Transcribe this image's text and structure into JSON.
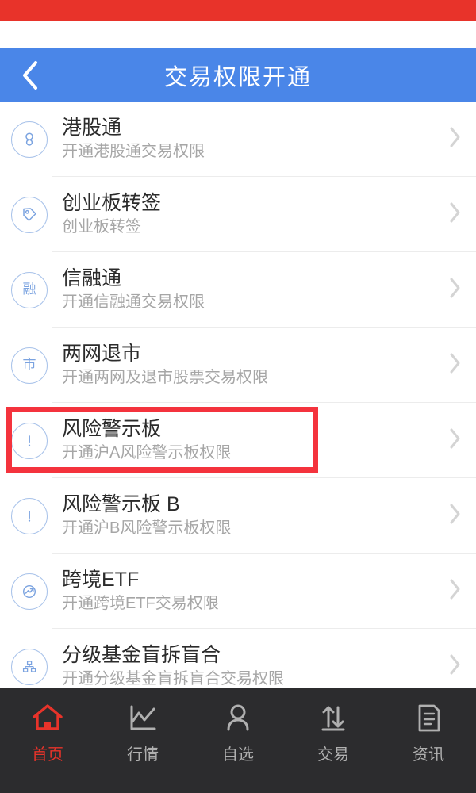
{
  "statusbar": {
    "color": "#e8332a"
  },
  "header": {
    "title": "交易权限开通",
    "back_label": "返回",
    "bg": "#4a86e8"
  },
  "list": {
    "items": [
      {
        "icon": "hongkong-stock-connect-icon",
        "title": "港股通",
        "subtitle": "开通港股通交易权限",
        "chevron": "chevron-right-icon"
      },
      {
        "icon": "tag-icon",
        "title": "创业板转签",
        "subtitle": "创业板转签",
        "chevron": "chevron-right-icon"
      },
      {
        "icon": "rong-badge-icon",
        "glyph": "融",
        "title": "信融通",
        "subtitle": "开通信融通交易权限",
        "chevron": "chevron-right-icon"
      },
      {
        "icon": "shi-badge-icon",
        "glyph": "市",
        "title": "两网退市",
        "subtitle": "开通两网及退市股票交易权限",
        "chevron": "chevron-right-icon"
      },
      {
        "icon": "warning-exclamation-icon",
        "title": "风险警示板",
        "subtitle": "开通沪A风险警示板权限",
        "chevron": "chevron-right-icon",
        "highlighted": true
      },
      {
        "icon": "warning-exclamation-icon",
        "title": "风险警示板 B",
        "subtitle": "开通沪B风险警示板权限",
        "chevron": "chevron-right-icon"
      },
      {
        "icon": "trend-chart-icon",
        "title": "跨境ETF",
        "subtitle": "开通跨境ETF交易权限",
        "chevron": "chevron-right-icon"
      },
      {
        "icon": "hierarchy-icon",
        "title": "分级基金盲拆盲合",
        "subtitle": "开通分级基金盲拆盲合交易权限",
        "chevron": "chevron-right-icon"
      }
    ]
  },
  "annotation": {
    "type": "red-highlight-rectangle",
    "target": "风险警示板",
    "color": "#f4333d"
  },
  "tabbar": {
    "active_color": "#e8332a",
    "inactive_color": "#b0b0b0",
    "tabs": [
      {
        "label": "首页",
        "icon": "home-icon",
        "active": true
      },
      {
        "label": "行情",
        "icon": "line-chart-icon",
        "active": false
      },
      {
        "label": "自选",
        "icon": "person-icon",
        "active": false
      },
      {
        "label": "交易",
        "icon": "transfer-arrows-icon",
        "active": false
      },
      {
        "label": "资讯",
        "icon": "document-icon",
        "active": false
      }
    ]
  }
}
